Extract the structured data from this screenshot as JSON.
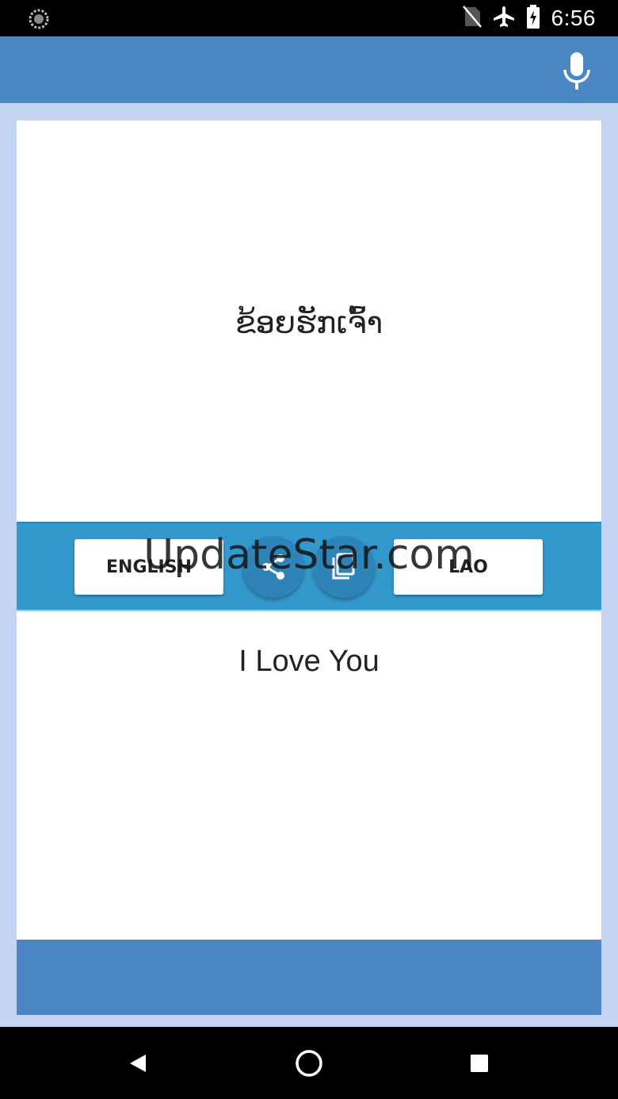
{
  "status_bar": {
    "time": "6:56",
    "icons": [
      "loading-spinner-icon",
      "no-sim-icon",
      "airplane-mode-icon",
      "battery-charging-icon"
    ]
  },
  "app_bar": {
    "mic_icon": "microphone-icon",
    "accent_color": "#4a87c4"
  },
  "translation": {
    "source_text": "ຂ້ອຍຮັກເຈົ້າ",
    "target_text": "I Love You"
  },
  "controls": {
    "left_language": "ENGLISH",
    "right_language": "LAO",
    "share_icon": "share-icon",
    "copy_icon": "copy-icon",
    "bar_color": "#3399cc"
  },
  "watermark": "UpdateStar.com",
  "nav_bar": {
    "icons": [
      "back-icon",
      "home-icon",
      "recent-apps-icon"
    ]
  }
}
